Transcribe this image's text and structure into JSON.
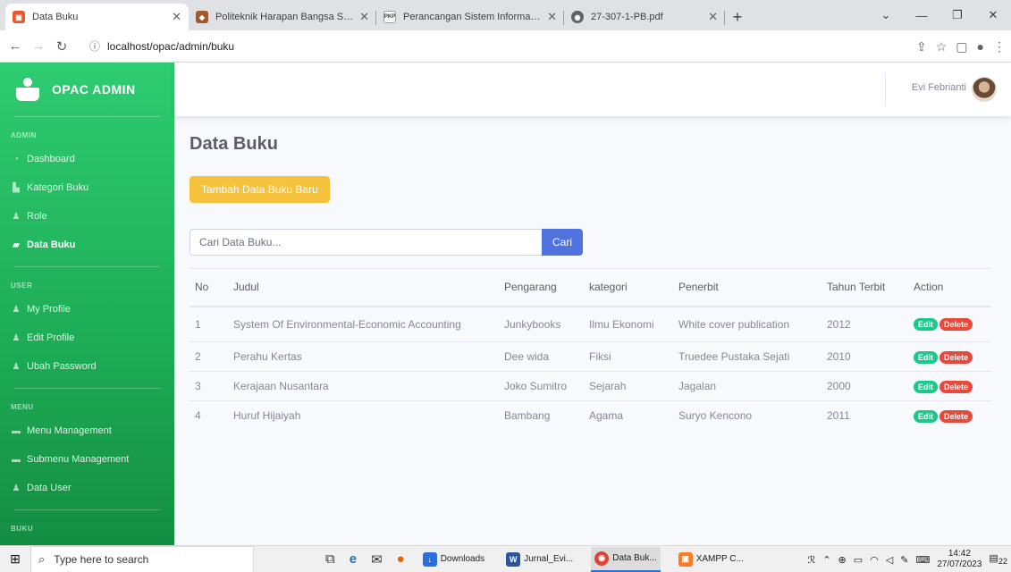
{
  "browser": {
    "tabs": [
      {
        "title": "Data Buku",
        "favicon_color": "#e8562a",
        "active": true
      },
      {
        "title": "Politeknik Harapan Bangsa Surak",
        "favicon_color": "#a05a2c",
        "active": false
      },
      {
        "title": "Perancangan Sistem Informasi Pe",
        "favicon_color": "#ffffff",
        "favicon_text": "PKP",
        "active": false
      },
      {
        "title": "27-307-1-PB.pdf",
        "favicon_color": "#5f6368",
        "active": false
      }
    ],
    "url": "localhost/opac/admin/buku"
  },
  "sidebar": {
    "brand": "OPAC ADMIN",
    "sections": {
      "admin": "ADMIN",
      "user": "USER",
      "menu": "MENU",
      "buku": "BUKU"
    },
    "items": {
      "dashboard": "Dashboard",
      "kategori": "Kategori Buku",
      "role": "Role",
      "data_buku": "Data Buku",
      "my_profile": "My Profile",
      "edit_profile": "Edit Profile",
      "ubah_password": "Ubah Password",
      "menu_management": "Menu Management",
      "submenu_management": "Submenu Management",
      "data_user": "Data User"
    }
  },
  "topbar": {
    "user_name": "Evi Febrianti"
  },
  "main": {
    "title": "Data Buku",
    "add_button": "Tambah Data Buku Baru",
    "search_placeholder": "Cari Data Buku...",
    "search_button": "Cari",
    "table": {
      "headers": [
        "No",
        "Judul",
        "Pengarang",
        "kategori",
        "Penerbit",
        "Tahun Terbit",
        "Action"
      ],
      "rows": [
        [
          "1",
          "System Of Environmental-Economic Accounting",
          "Junkybooks",
          "Ilmu Ekonomi",
          "White cover publication",
          "2012"
        ],
        [
          "2",
          "Perahu Kertas",
          "Dee wida",
          "Fiksi",
          "Truedee Pustaka Sejati",
          "2010"
        ],
        [
          "3",
          "Kerajaan Nusantara",
          "Joko Sumitro",
          "Sejarah",
          "Jagalan",
          "2000"
        ],
        [
          "4",
          "Huruf Hijaiyah",
          "Bambang",
          "Agama",
          "Suryo Kencono",
          "2011"
        ]
      ],
      "edit_label": "Edit",
      "delete_label": "Delete"
    }
  },
  "taskbar": {
    "search_placeholder": "Type here to search",
    "apps": {
      "downloads": "Downloads",
      "word": "Jurnal_Evi...",
      "chrome": "Data Buk...",
      "xampp": "XAMPP C..."
    },
    "time": "14:42",
    "date": "27/07/2023",
    "notifications": "22"
  },
  "colors": {
    "sidebar_top": "#2ecc71",
    "sidebar_bottom": "#148d42",
    "primary": "#4e73df",
    "warning": "#f6c23e",
    "success": "#1cc88a",
    "danger": "#e74a3b"
  }
}
